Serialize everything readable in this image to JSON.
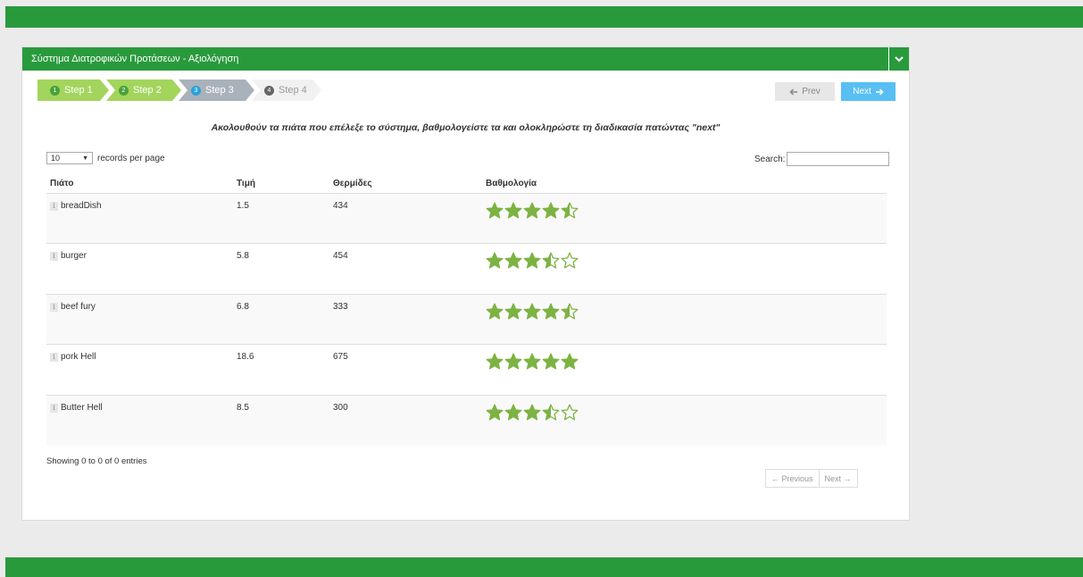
{
  "colors": {
    "brand": "#299a3c",
    "step_done": "#a3d55d",
    "step_current": "#a9b2bb",
    "next": "#58bff3",
    "star": "#7cb342"
  },
  "panel": {
    "title": "Σύστημα Διατροφικών Προτάσεων - Αξιολόγηση",
    "collapse_icon": "chevron-down-icon"
  },
  "wizard": {
    "steps": [
      {
        "num": "1",
        "label": "Step 1",
        "state": "done"
      },
      {
        "num": "2",
        "label": "Step 2",
        "state": "done"
      },
      {
        "num": "3",
        "label": "Step 3",
        "state": "current"
      },
      {
        "num": "4",
        "label": "Step 4",
        "state": "todo"
      }
    ],
    "prev_label": "Prev",
    "next_label": "Next"
  },
  "instruction": "Ακολουθούν τα πιάτα που επέλεξε το σύστημα, βαθμολογείστε τα και ολοκληρώστε τη διαδικασία πατώντας \"next\"",
  "table_controls": {
    "length_value": "10",
    "length_suffix": "records per page",
    "search_label": "Search:"
  },
  "table": {
    "columns": [
      "Πιάτο",
      "Τιμή",
      "Θερμίδες",
      "Βαθμολογία"
    ],
    "rows": [
      {
        "dish": "breadDish",
        "price": "1.5",
        "calories": "434",
        "rating": 4.5
      },
      {
        "dish": "burger",
        "price": "5.8",
        "calories": "454",
        "rating": 3.5
      },
      {
        "dish": "beef fury",
        "price": "6.8",
        "calories": "333",
        "rating": 4.5
      },
      {
        "dish": "pork Hell",
        "price": "18.6",
        "calories": "675",
        "rating": 5
      },
      {
        "dish": "Butter Hell",
        "price": "8.5",
        "calories": "300",
        "rating": 3.5
      }
    ]
  },
  "info": "Showing 0 to 0 of 0 entries",
  "pagination": {
    "previous": "← Previous",
    "next": "Next →"
  }
}
